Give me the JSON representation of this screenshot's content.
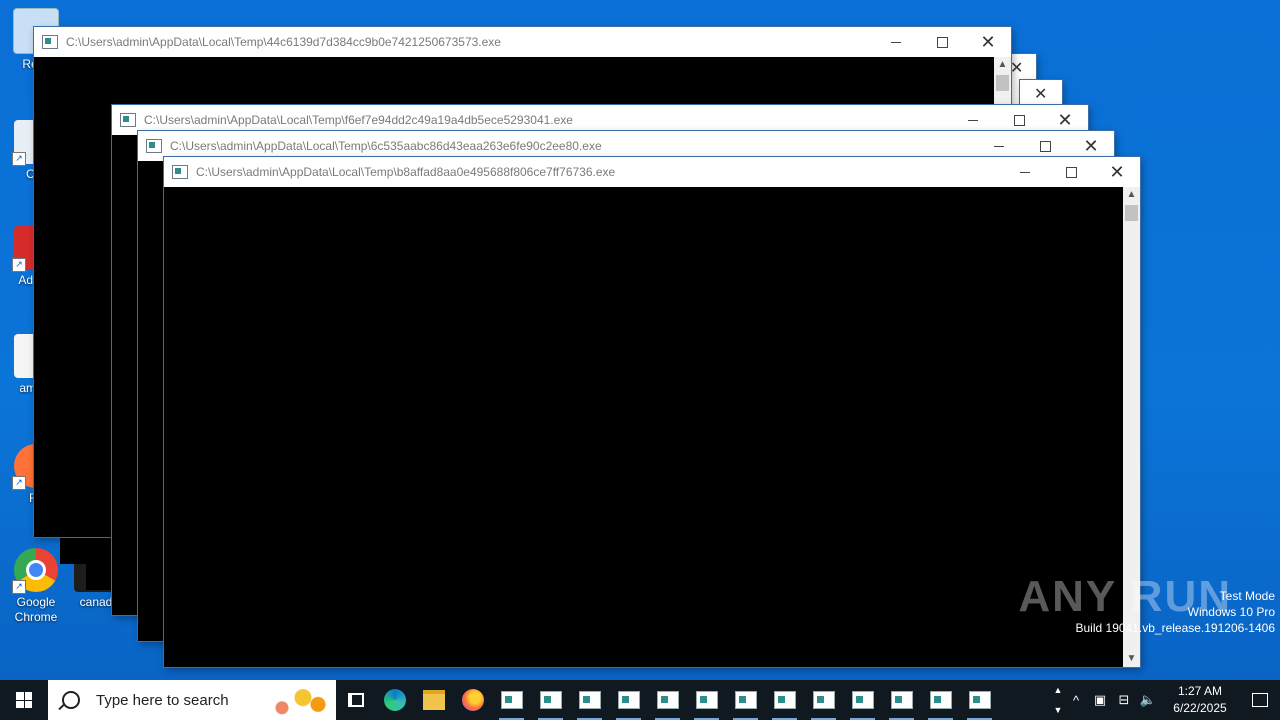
{
  "desktop": {
    "icons": [
      {
        "label": "Recy",
        "color": "#c9dff5"
      },
      {
        "label": "CCl",
        "color": "#e8eef5"
      },
      {
        "label": "Ad Acr",
        "color": "#d62b2b"
      },
      {
        "label": "amate",
        "color": "#f5f5f5"
      },
      {
        "label": "Fir",
        "color": "#ff7139"
      },
      {
        "label": "Google Chrome",
        "color": "#4285f4"
      },
      {
        "label": "canad",
        "color": "#1d1d1d"
      }
    ]
  },
  "windows": [
    {
      "title": "C:\\Users\\admin\\AppData\\Local\\Temp\\44c6139d7d384cc9b0e7421250673573.exe"
    },
    {
      "title": "C:\\Users\\admin\\AppData\\Local\\Temp\\f6ef7e94dd2c49a19a4db5ece5293041.exe"
    },
    {
      "title": "C:\\Users\\admin\\AppData\\Local\\Temp\\6c535aabc86d43eaa263e6fe90c2ee80.exe"
    },
    {
      "title": "C:\\Users\\admin\\AppData\\Local\\Temp\\b8affad8aa0e495688f806ce7ff76736.exe"
    }
  ],
  "watermark": "ANY RUN",
  "system_info": {
    "line1": "Test Mode",
    "line2": "Windows 10 Pro",
    "line3": "Build 19041.vb_release.191206-1406"
  },
  "taskbar": {
    "search_placeholder": "Type here to search",
    "time": "1:27 AM",
    "date": "6/22/2025"
  }
}
